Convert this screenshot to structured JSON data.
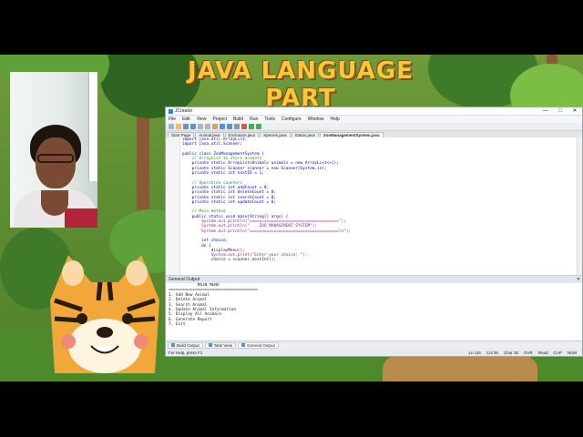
{
  "video_title": "JAVA LANGUAGE PART",
  "ide": {
    "window_title": "JCreator",
    "window_controls": [
      "—",
      "□",
      "✕"
    ],
    "menu": [
      "File",
      "Edit",
      "View",
      "Project",
      "Build",
      "Run",
      "Tools",
      "Configure",
      "Window",
      "Help"
    ],
    "tabs": [
      "Start Page",
      "Animal.java",
      "Enclosure.java",
      "Species.java",
      "Status.java",
      "ZooManagementSystem.java"
    ],
    "active_tab_index": 5,
    "code_lines": [
      "import java.util.ArrayList;",
      "import java.util.Scanner;",
      "",
      "public class ZooManagementSystem {",
      "    // ArrayList to store animals",
      "    private static ArrayList<Animal> animals = new ArrayList<>();",
      "    private static Scanner scanner = new Scanner(System.in);",
      "    private static int nextID = 1;",
      "",
      "    // Operation counters",
      "    private static int addCount = 0;",
      "    private static int deleteCount = 0;",
      "    private static int searchCount = 0;",
      "    private static int updateCount = 0;",
      "",
      "    // Main method",
      "    public static void main(String[] args) {",
      "        System.out.println(\"=====================================\");",
      "        System.out.println(\"    ZOO MANAGEMENT SYSTEM\");",
      "        System.out.println(\"=====================================\\n\");",
      "",
      "        int choice;",
      "        do {",
      "            displayMenu();",
      "            System.out.print(\"Enter your choice: \");",
      "            choice = scanner.nextInt();"
    ],
    "output_panel_title": "General Output",
    "output_lines": [
      "            MAIN MENU",
      "=====================================",
      "1. Add New Animal",
      "2. Delete Animal",
      "3. Search Animal",
      "4. Update Animal Information",
      "5. Display All Animals",
      "6. Generate Report",
      "7. Exit"
    ],
    "bottom_tabs": [
      "Build Output",
      "Task View",
      "General Output"
    ],
    "active_bottom_tab_index": 2,
    "status_left": "For Help, press F1",
    "status_right": [
      "Ln 116",
      "Col 35",
      "Char 35",
      "OVR",
      "Read",
      "CAP",
      "NUM"
    ]
  }
}
